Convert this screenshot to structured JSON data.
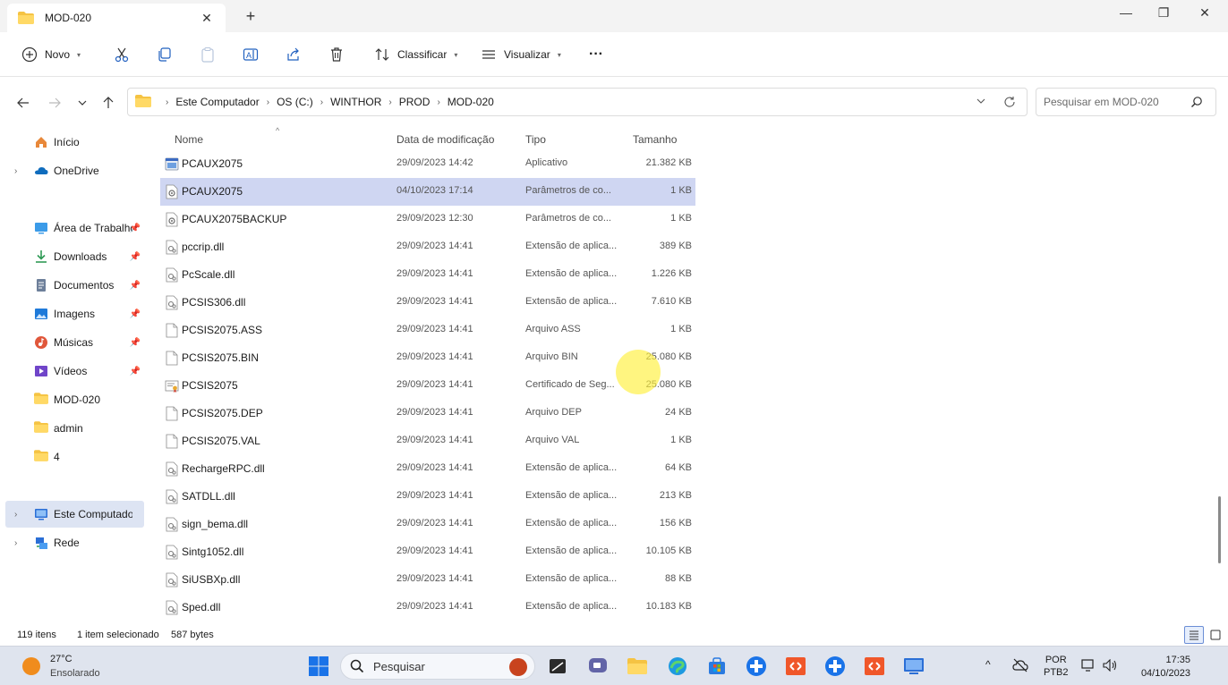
{
  "window": {
    "tab_title": "MOD-020",
    "new_tab": "+",
    "close_tab": "✕",
    "minimize": "—",
    "maximize": "❐",
    "close": "✕"
  },
  "commandbar": {
    "new_label": "Novo",
    "sort_label": "Classificar",
    "view_label": "Visualizar",
    "more": "···"
  },
  "address": {
    "crumbs": [
      "Este Computador",
      "OS (C:)",
      "WINTHOR",
      "PROD",
      "MOD-020"
    ],
    "search_placeholder": "Pesquisar em MOD-020"
  },
  "sidebar": {
    "items": [
      {
        "label": "Início",
        "icon": "home-icon",
        "pinned": false
      },
      {
        "label": "OneDrive",
        "icon": "cloud-icon",
        "pinned": false
      },
      {
        "label": "Área de Trabalho",
        "icon": "desktop-icon",
        "pinned": true
      },
      {
        "label": "Downloads",
        "icon": "download-icon",
        "pinned": true
      },
      {
        "label": "Documentos",
        "icon": "document-icon",
        "pinned": true
      },
      {
        "label": "Imagens",
        "icon": "image-icon",
        "pinned": true
      },
      {
        "label": "Músicas",
        "icon": "music-icon",
        "pinned": true
      },
      {
        "label": "Vídeos",
        "icon": "video-icon",
        "pinned": true
      },
      {
        "label": "MOD-020",
        "icon": "folder-icon",
        "pinned": false
      },
      {
        "label": "admin",
        "icon": "folder-icon",
        "pinned": false
      },
      {
        "label": "4",
        "icon": "folder-icon",
        "pinned": false
      },
      {
        "label": "Este Computador",
        "icon": "computer-icon",
        "pinned": false
      },
      {
        "label": "Rede",
        "icon": "network-icon",
        "pinned": false
      }
    ]
  },
  "columns": {
    "name": "Nome",
    "date": "Data de modificação",
    "type": "Tipo",
    "size": "Tamanho"
  },
  "files": [
    {
      "name": "PCAUX2075",
      "date": "29/09/2023 14:42",
      "type": "Aplicativo",
      "size": "21.382 KB",
      "icon": "application-icon"
    },
    {
      "name": "PCAUX2075",
      "date": "04/10/2023 17:14",
      "type": "Parâmetros de co...",
      "size": "1 KB",
      "icon": "config-file-icon"
    },
    {
      "name": "PCAUX2075BACKUP",
      "date": "29/09/2023 12:30",
      "type": "Parâmetros de co...",
      "size": "1 KB",
      "icon": "config-file-icon"
    },
    {
      "name": "pccrip.dll",
      "date": "29/09/2023 14:41",
      "type": "Extensão de aplica...",
      "size": "389 KB",
      "icon": "dll-file-icon"
    },
    {
      "name": "PcScale.dll",
      "date": "29/09/2023 14:41",
      "type": "Extensão de aplica...",
      "size": "1.226 KB",
      "icon": "dll-file-icon"
    },
    {
      "name": "PCSIS306.dll",
      "date": "29/09/2023 14:41",
      "type": "Extensão de aplica...",
      "size": "7.610 KB",
      "icon": "dll-file-icon"
    },
    {
      "name": "PCSIS2075.ASS",
      "date": "29/09/2023 14:41",
      "type": "Arquivo ASS",
      "size": "1 KB",
      "icon": "blank-file-icon"
    },
    {
      "name": "PCSIS2075.BIN",
      "date": "29/09/2023 14:41",
      "type": "Arquivo BIN",
      "size": "25.080 KB",
      "icon": "blank-file-icon"
    },
    {
      "name": "PCSIS2075",
      "date": "29/09/2023 14:41",
      "type": "Certificado de Seg...",
      "size": "25.080 KB",
      "icon": "certificate-icon"
    },
    {
      "name": "PCSIS2075.DEP",
      "date": "29/09/2023 14:41",
      "type": "Arquivo DEP",
      "size": "24 KB",
      "icon": "blank-file-icon"
    },
    {
      "name": "PCSIS2075.VAL",
      "date": "29/09/2023 14:41",
      "type": "Arquivo VAL",
      "size": "1 KB",
      "icon": "blank-file-icon"
    },
    {
      "name": "RechargeRPC.dll",
      "date": "29/09/2023 14:41",
      "type": "Extensão de aplica...",
      "size": "64 KB",
      "icon": "dll-file-icon"
    },
    {
      "name": "SATDLL.dll",
      "date": "29/09/2023 14:41",
      "type": "Extensão de aplica...",
      "size": "213 KB",
      "icon": "dll-file-icon"
    },
    {
      "name": "sign_bema.dll",
      "date": "29/09/2023 14:41",
      "type": "Extensão de aplica...",
      "size": "156 KB",
      "icon": "dll-file-icon"
    },
    {
      "name": "Sintg1052.dll",
      "date": "29/09/2023 14:41",
      "type": "Extensão de aplica...",
      "size": "10.105 KB",
      "icon": "dll-file-icon"
    },
    {
      "name": "SiUSBXp.dll",
      "date": "29/09/2023 14:41",
      "type": "Extensão de aplica...",
      "size": "88 KB",
      "icon": "dll-file-icon"
    },
    {
      "name": "Sped.dll",
      "date": "29/09/2023 14:41",
      "type": "Extensão de aplica...",
      "size": "10.183 KB",
      "icon": "dll-file-icon"
    }
  ],
  "status": {
    "item_count": "119 itens",
    "selection": "1 item selecionado",
    "selection_size": "587 bytes"
  },
  "taskbar": {
    "temperature": "27°C",
    "weather": "Ensolarado",
    "search_label": "Pesquisar",
    "lang_top": "POR",
    "lang_bottom": "PTB2",
    "time": "17:35",
    "date": "04/10/2023"
  },
  "colors": {
    "selected_row": "#cfd6f2",
    "selected_side": "#dde4f3",
    "folder": "#f5c343",
    "accent": "#0067c0"
  }
}
